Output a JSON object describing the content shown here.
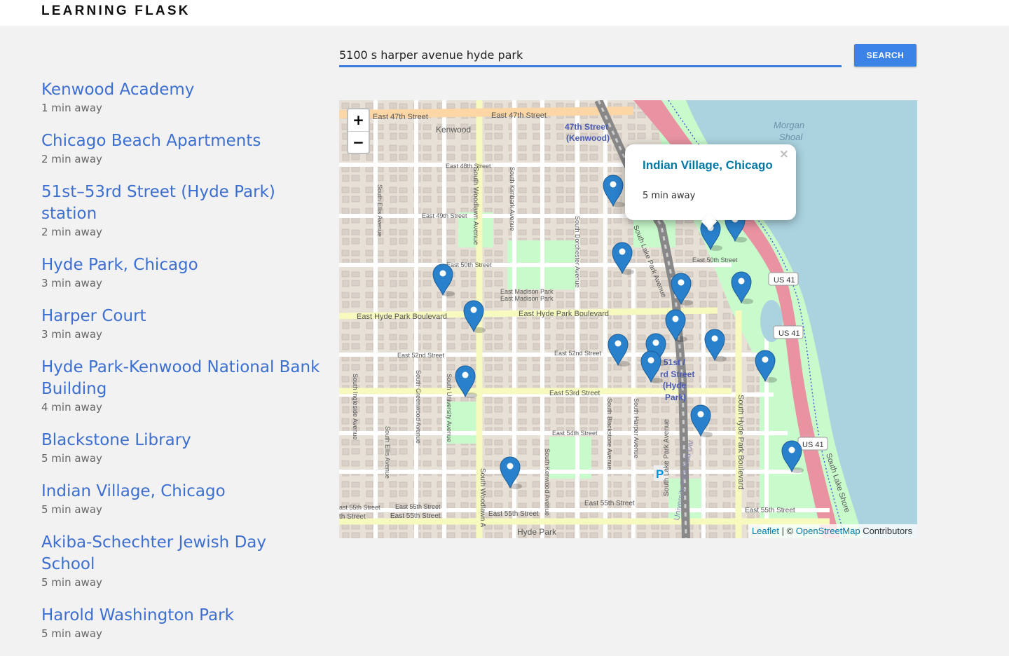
{
  "brand": "LEARNING FLASK",
  "search": {
    "value": "5100 s harper avenue hyde park",
    "button_label": "SEARCH"
  },
  "results": [
    {
      "name": "Kenwood Academy",
      "time": "1 min away"
    },
    {
      "name": "Chicago Beach Apartments",
      "time": "2 min away"
    },
    {
      "name": "51st–53rd Street (Hyde Park) station",
      "time": "2 min away"
    },
    {
      "name": "Hyde Park, Chicago",
      "time": "3 min away"
    },
    {
      "name": "Harper Court",
      "time": "3 min away"
    },
    {
      "name": "Hyde Park-Kenwood National Bank Building",
      "time": "4 min away"
    },
    {
      "name": "Blackstone Library",
      "time": "5 min away"
    },
    {
      "name": "Indian Village, Chicago",
      "time": "5 min away"
    },
    {
      "name": "Akiba-Schechter Jewish Day School",
      "time": "5 min away"
    },
    {
      "name": "Harold Washington Park",
      "time": "5 min away"
    }
  ],
  "map": {
    "zoom_in": "+",
    "zoom_out": "−",
    "popup": {
      "title": "Indian Village, Chicago",
      "subtitle": "5 min away",
      "close": "×"
    },
    "attribution": {
      "leaflet": "Leaflet",
      "separator": " | © ",
      "osm": "OpenStreetMap",
      "suffix": " Contributors"
    },
    "labels": {
      "e47a": "East 47th Street",
      "e47b": "East 47th Street",
      "kenwood": "Kenwood",
      "station47a": "47th Street",
      "station47b": "(Kenwood)",
      "morgan1": "Morgan",
      "morgan2": "Shoal",
      "e48": "East 48th Street",
      "e49": "East 49th Street",
      "e50": "East 50th Street",
      "e50b": "East 50th Street",
      "madison1": "East Madison Park",
      "madison2": "East Madison Park",
      "hpb1": "East Hyde Park Boulevard",
      "hpb2": "East Hyde Park Boulevard",
      "e52a": "East 52nd Street",
      "e52b": "East 52nd Street",
      "e53": "East 53rd Street",
      "e54": "East 54th Street",
      "e55a": "East 55th Street",
      "e55b": "East 55th Street",
      "e55c": "East 55th Street",
      "e55d": "East 55th Street",
      "e55e": "ast 55th Street",
      "e55f": "th Street",
      "e55g": "East 55th Street",
      "st51a": "51st /",
      "st51b": "rd Street",
      "st51c": "(Hyde",
      "st51d": "Park)",
      "us41a": "US 41",
      "us41b": "US 41",
      "us41c": "US 41",
      "hydepark": "Hyde Park",
      "woodlawn": "South Woodlawn Avenue",
      "woodlawn2": "South Woodlawn A",
      "kimbark": "South Kimbark Avenue",
      "dorchester": "South Dorchester Avenue",
      "lakepark": "South Lake Park Avenue",
      "lakepark2": "South Lake Park Avenue",
      "ellis": "South Ellis Avenue",
      "ellis2": "South Ellis Avenue",
      "ingleside": "South Ingleside Avenue",
      "greenwood": "South Greenwood Avenue",
      "university": "South University Avenue",
      "kenwoodave": "South Kenwood Avenue",
      "blackstone": "South Blackstone Avenue",
      "harper": "South Harper Avenue",
      "hpblvd": "South Hyde Park Boulevard",
      "lakeshore": "South Lake Shore",
      "univpark": "University Park Sub Div",
      "parking": "P"
    },
    "colors": {
      "water": "#aad3df",
      "park": "#c8facc",
      "land": "#e6e0d6",
      "road_major": "#f7fabf",
      "road_primary": "#fcd6a4",
      "highway": "#e892a2",
      "rail": "#999999",
      "marker": "#2a81cb"
    }
  }
}
